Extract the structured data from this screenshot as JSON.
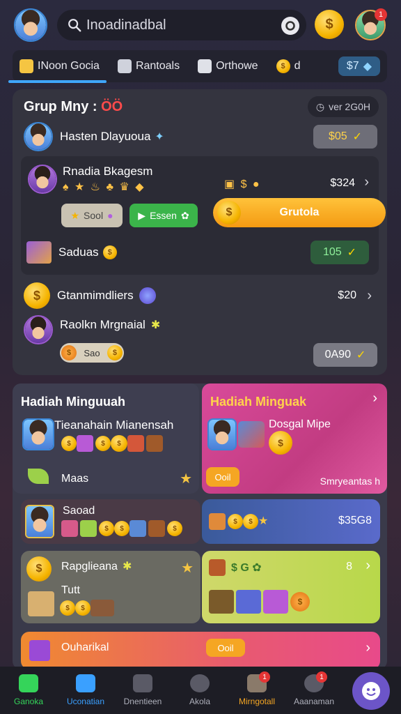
{
  "header": {
    "search_text": "Inoadinadbal",
    "notification_count": "1"
  },
  "tabs": [
    {
      "label": "INoon Gocia"
    },
    {
      "label": "Rantoals"
    },
    {
      "label": "Orthowe"
    },
    {
      "label": "d"
    },
    {
      "label": "$7"
    }
  ],
  "group": {
    "title": "Grup Mny :",
    "title_accent": "ÖÖ",
    "version": "ver 2G0H",
    "rows": [
      {
        "name": "Hasten Dlayuoua",
        "badge": "$05"
      },
      {
        "name": "Rnadia Bkagesm",
        "price": "$324",
        "button_left": "Sool",
        "button_mid": "Essen",
        "button_main": "Grutola"
      },
      {
        "name": "Saduas",
        "badge": "105"
      },
      {
        "name": "Gtanmimdliers",
        "price": "$20"
      },
      {
        "name": "Raolkn Mrgnaial",
        "chip": "Sao",
        "badge": "0A90"
      }
    ]
  },
  "panels": {
    "left_title": "Hadiah Minguuah",
    "left_label": "Maas",
    "right_title": "Hadiah Minguak",
    "right_sub": "Dosgal Mipe",
    "right_tag": "Ooil",
    "right_foot": "Smryeantas h",
    "mid_left": "Saoad",
    "mid_right_price": "$35G8",
    "bottom_left_title": "Rapglieana",
    "bottom_left_sub": "Tutt",
    "bottom_right_count": "8",
    "last_title": "Ouharikal",
    "last_tag": "Ooil"
  },
  "bottom_nav": [
    {
      "label": "Ganoka",
      "color": "#35d45a"
    },
    {
      "label": "Uconatian",
      "color": "#3aa0ff"
    },
    {
      "label": "Dnentieen",
      "color": "#aeb0bb"
    },
    {
      "label": "Akola",
      "color": "#aeb0bb"
    },
    {
      "label": "Mirngotall",
      "color": "#f5a623",
      "badge": "1"
    },
    {
      "label": "Aaanaman",
      "color": "#aeb0bb",
      "badge": "1"
    }
  ]
}
